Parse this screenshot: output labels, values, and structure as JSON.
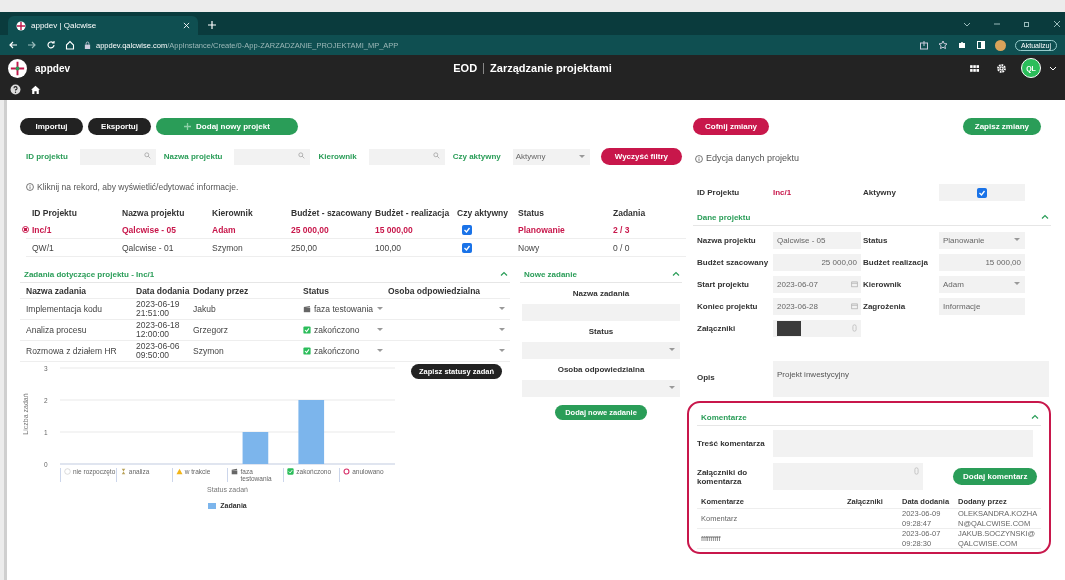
{
  "browser": {
    "tab_title": "appdev | Qalcwise",
    "url_host": "appdev.qalcwise.com",
    "url_path": "/AppInstance/Create/0-App-ZARZADZANIE_PROJEKTAMI_MP_APP",
    "update_button": "Aktualizuj"
  },
  "app_header": {
    "app_name": "appdev",
    "title_prefix": "EOD",
    "title": "Zarządzanie projektami",
    "avatar": "QL"
  },
  "toolbar": [
    {
      "label": "Importuj",
      "kind": "dark"
    },
    {
      "label": "Eksportuj",
      "kind": "dark"
    },
    {
      "label": "Dodaj nowy projekt",
      "kind": "add"
    }
  ],
  "filters": [
    {
      "label": "ID projektu",
      "kind": "search"
    },
    {
      "label": "Nazwa projektu",
      "kind": "search"
    },
    {
      "label": "Kierownik",
      "kind": "search"
    },
    {
      "label": "Czy aktywny",
      "kind": "select",
      "value": "Aktywny"
    }
  ],
  "clear_filters": "Wyczyść filtry",
  "hint": "Kliknij na rekord, aby wyświetlić/edytować informacje.",
  "projects": {
    "columns": [
      "ID Projektu",
      "Nazwa projektu",
      "Kierownik",
      "Budżet - szacowany",
      "Budżet - realizacja",
      "Czy aktywny",
      "Status",
      "Zadania"
    ],
    "rows": [
      {
        "id": "Inc/1",
        "name": "Qalcwise - 05",
        "manager": "Adam",
        "budget_planned": "25 000,00",
        "budget_actual": "15 000,00",
        "active": true,
        "status": "Planowanie",
        "tasks": "2 / 3",
        "selected": true
      },
      {
        "id": "QW/1",
        "name": "Qalcwise - 01",
        "manager": "Szymon",
        "budget_planned": "250,00",
        "budget_actual": "100,00",
        "active": true,
        "status": "Nowy",
        "tasks": "0 / 0",
        "selected": false
      }
    ]
  },
  "tasks": {
    "title": "Zadania dotyczące projektu - Inc/1",
    "expanded": true,
    "columns": [
      "Nazwa zadania",
      "Data dodania",
      "Dodany przez",
      "Status",
      "Osoba odpowiedzialna"
    ],
    "rows": [
      {
        "name": "Implementacja kodu",
        "date": "2023-06-19",
        "time": "21:51:00",
        "added_by": "Jakub",
        "status": "faza testowania",
        "kind": "clapper"
      },
      {
        "name": "Analiza procesu",
        "date": "2023-06-18",
        "time": "12:00:00",
        "added_by": "Grzegorz",
        "status": "zakończono",
        "kind": "check"
      },
      {
        "name": "Rozmowa z działem HR",
        "date": "2023-06-06",
        "time": "09:50:00",
        "added_by": "Szymon",
        "status": "zakończono",
        "kind": "check"
      }
    ],
    "save_button": "Zapisz statusy zadań",
    "category_icons": [
      {
        "kind": "empty-circle"
      },
      {
        "kind": "hourglass"
      },
      {
        "kind": "warning"
      },
      {
        "kind": "clapper"
      },
      {
        "kind": "check"
      },
      {
        "kind": "ring"
      }
    ],
    "chart_data": {
      "type": "bar",
      "xlabel": "Status zadań",
      "ylabel": "Liczba zadań",
      "categories": [
        "nie rozpoczęto",
        "analiza",
        "w trakcie",
        "faza testowania",
        "zakończono",
        "anulowano"
      ],
      "series": [
        {
          "name": "Zadania",
          "color": "#7cb5ec",
          "values": [
            0,
            0,
            0,
            1,
            2,
            0
          ]
        }
      ],
      "ylim": [
        0,
        3
      ],
      "yticks": [
        0,
        1,
        2,
        3
      ]
    }
  },
  "new_task": {
    "title": "Nowe zadanie",
    "expanded": true,
    "fields": [
      {
        "label": "Nazwa zadania",
        "kind": "text"
      },
      {
        "label": "Status",
        "kind": "select"
      },
      {
        "label": "Osoba odpowiedzialna",
        "kind": "select"
      }
    ],
    "button": "Dodaj nowe zadanie"
  },
  "editor": {
    "undo_button": "Cofnij zmiany",
    "save_button": "Zapisz zmiany",
    "hint": "Edycja danych projektu",
    "id_label": "ID Projektu",
    "id_value": "Inc/1",
    "active_label": "Aktywny",
    "active": true,
    "section": "Dane projektu",
    "expanded": true,
    "fields": [
      {
        "label": "Nazwa projektu",
        "value": "Qalcwise - 05",
        "kind": "text"
      },
      {
        "label": "Status",
        "value": "Planowanie",
        "kind": "select"
      },
      {
        "label": "Budżet szacowany",
        "value": "25 000,00",
        "kind": "number"
      },
      {
        "label": "Budżet realizacja",
        "value": "15 000,00",
        "kind": "number"
      },
      {
        "label": "Start projektu",
        "value": "2023-06-07",
        "kind": "date"
      },
      {
        "label": "Kierownik",
        "value": "Adam",
        "kind": "select"
      },
      {
        "label": "Koniec projektu",
        "value": "2023-06-28",
        "kind": "date"
      },
      {
        "label": "Zagrożenia",
        "value": "Informacje",
        "kind": "text"
      },
      {
        "label": "Załączniki",
        "kind": "file"
      }
    ],
    "description": {
      "label": "Opis",
      "value": "Projekt inwestycyjny"
    }
  },
  "comments": {
    "title": "Komentarze",
    "expanded": true,
    "content_label": "Treść komentarza",
    "attachments_label": "Załączniki do komentarza",
    "add_button": "Dodaj komentarz",
    "columns": [
      "Komentarze",
      "Załączniki",
      "Data dodania",
      "Dodany przez"
    ],
    "rows": [
      {
        "text": "Komentarz",
        "date": "2023-06-09",
        "time": "09:28:47",
        "author": "OLEKSANDRA.KOZHAN@QALCWISE.COM"
      },
      {
        "text": "ffffffffff",
        "date": "2023-06-07",
        "time": "09:28:30",
        "author": "JAKUB.SOCZYNSKI@QALCWISE.COM"
      }
    ]
  }
}
